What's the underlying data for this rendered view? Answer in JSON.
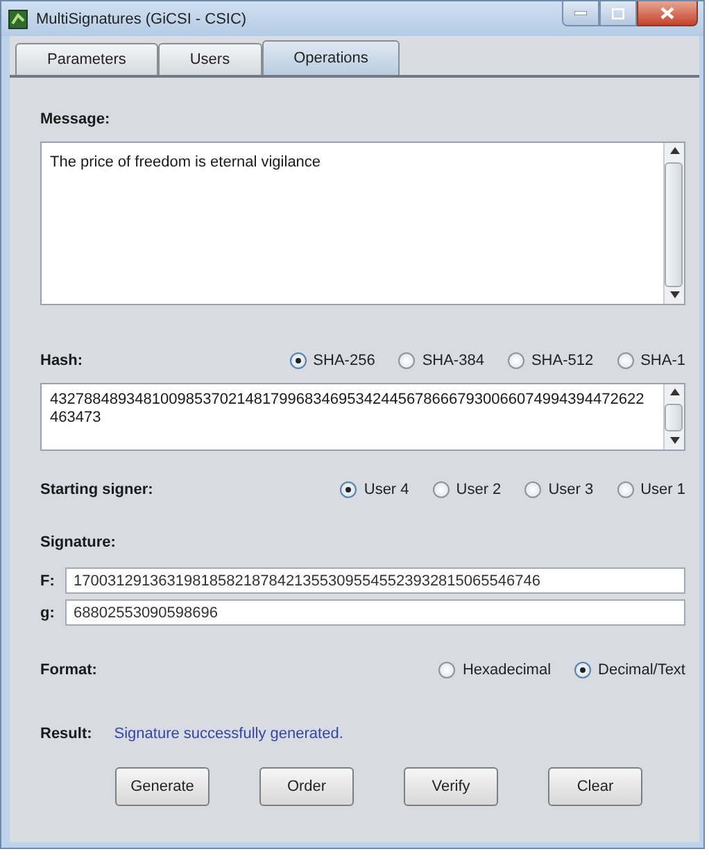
{
  "window": {
    "title": "MultiSignatures (GiCSI - CSIC)"
  },
  "tabs": [
    {
      "label": "Parameters",
      "selected": false
    },
    {
      "label": "Users",
      "selected": false
    },
    {
      "label": "Operations",
      "selected": true
    }
  ],
  "message": {
    "label": "Message:",
    "value": "The price of freedom is eternal vigilance"
  },
  "hash": {
    "label": "Hash:",
    "options": [
      {
        "label": "SHA-256",
        "selected": true
      },
      {
        "label": "SHA-384",
        "selected": false
      },
      {
        "label": "SHA-512",
        "selected": false
      },
      {
        "label": "SHA-1",
        "selected": false
      }
    ],
    "value": "4327884893481009853702148179968346953424456786667930066074994394472622463473"
  },
  "starting_signer": {
    "label": "Starting signer:",
    "options": [
      {
        "label": "User 4",
        "selected": true
      },
      {
        "label": "User 2",
        "selected": false
      },
      {
        "label": "User 3",
        "selected": false
      },
      {
        "label": "User 1",
        "selected": false
      }
    ]
  },
  "signature": {
    "label": "Signature:",
    "fields": [
      {
        "label": "F:",
        "value": "1700312913631981858218784213553095545523932815065546746"
      },
      {
        "label": "g:",
        "value": "68802553090598696"
      }
    ]
  },
  "format": {
    "label": "Format:",
    "options": [
      {
        "label": "Hexadecimal",
        "selected": false
      },
      {
        "label": "Decimal/Text",
        "selected": true
      }
    ]
  },
  "result": {
    "label": "Result:",
    "value": "Signature successfully generated."
  },
  "buttons": [
    "Generate",
    "Order",
    "Verify",
    "Clear"
  ]
}
